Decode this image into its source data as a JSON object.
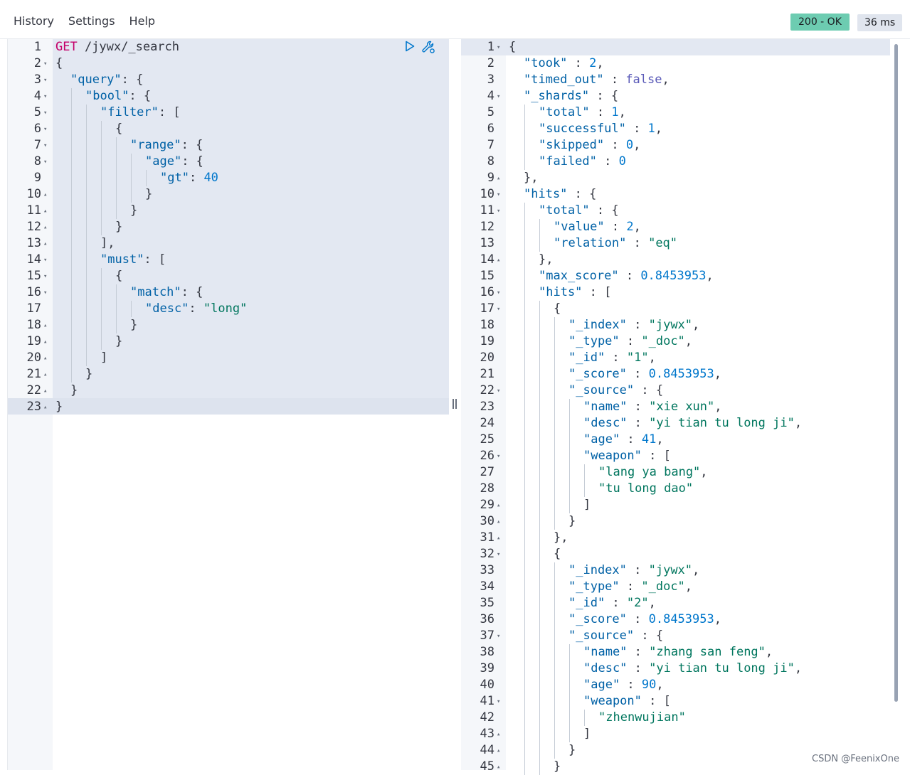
{
  "menu": {
    "history": "History",
    "settings": "Settings",
    "help": "Help"
  },
  "status": {
    "code": "200 - OK",
    "time": "36 ms"
  },
  "icons": {
    "run": "play-icon",
    "settings": "wrench-icon"
  },
  "request": {
    "lines": [
      {
        "n": "1",
        "fold": "",
        "tokens": [
          [
            "method",
            "GET"
          ],
          [
            "url",
            " /jywx/_search"
          ]
        ]
      },
      {
        "n": "2",
        "fold": "down",
        "tokens": [
          [
            "punc",
            "{"
          ]
        ]
      },
      {
        "n": "3",
        "fold": "down",
        "tokens": [
          [
            "key",
            "\"query\""
          ],
          [
            "punc",
            ": {"
          ]
        ]
      },
      {
        "n": "4",
        "fold": "down",
        "tokens": [
          [
            "key",
            "\"bool\""
          ],
          [
            "punc",
            ": {"
          ]
        ]
      },
      {
        "n": "5",
        "fold": "down",
        "tokens": [
          [
            "key",
            "\"filter\""
          ],
          [
            "punc",
            ": ["
          ]
        ]
      },
      {
        "n": "6",
        "fold": "down",
        "tokens": [
          [
            "punc",
            "{"
          ]
        ]
      },
      {
        "n": "7",
        "fold": "down",
        "tokens": [
          [
            "key",
            "\"range\""
          ],
          [
            "punc",
            ": {"
          ]
        ]
      },
      {
        "n": "8",
        "fold": "down",
        "tokens": [
          [
            "key",
            "\"age\""
          ],
          [
            "punc",
            ": {"
          ]
        ]
      },
      {
        "n": "9",
        "fold": "",
        "tokens": [
          [
            "key",
            "\"gt\""
          ],
          [
            "punc",
            ": "
          ],
          [
            "num",
            "40"
          ]
        ]
      },
      {
        "n": "10",
        "fold": "up",
        "tokens": [
          [
            "punc",
            "}"
          ]
        ]
      },
      {
        "n": "11",
        "fold": "up",
        "tokens": [
          [
            "punc",
            "}"
          ]
        ]
      },
      {
        "n": "12",
        "fold": "up",
        "tokens": [
          [
            "punc",
            "}"
          ]
        ]
      },
      {
        "n": "13",
        "fold": "up",
        "tokens": [
          [
            "punc",
            "],"
          ]
        ]
      },
      {
        "n": "14",
        "fold": "down",
        "tokens": [
          [
            "key",
            "\"must\""
          ],
          [
            "punc",
            ": ["
          ]
        ]
      },
      {
        "n": "15",
        "fold": "down",
        "tokens": [
          [
            "punc",
            "{"
          ]
        ]
      },
      {
        "n": "16",
        "fold": "down",
        "tokens": [
          [
            "key",
            "\"match\""
          ],
          [
            "punc",
            ": {"
          ]
        ]
      },
      {
        "n": "17",
        "fold": "",
        "tokens": [
          [
            "key",
            "\"desc\""
          ],
          [
            "punc",
            ": "
          ],
          [
            "str",
            "\"long\""
          ]
        ]
      },
      {
        "n": "18",
        "fold": "up",
        "tokens": [
          [
            "punc",
            "}"
          ]
        ]
      },
      {
        "n": "19",
        "fold": "up",
        "tokens": [
          [
            "punc",
            "}"
          ]
        ]
      },
      {
        "n": "20",
        "fold": "up",
        "tokens": [
          [
            "punc",
            "]"
          ]
        ]
      },
      {
        "n": "21",
        "fold": "up",
        "tokens": [
          [
            "punc",
            "}"
          ]
        ]
      },
      {
        "n": "22",
        "fold": "up",
        "tokens": [
          [
            "punc",
            "}"
          ]
        ]
      },
      {
        "n": "23",
        "fold": "up",
        "tokens": [
          [
            "punc",
            "}"
          ]
        ]
      }
    ]
  },
  "response": {
    "lines": [
      {
        "n": "1",
        "fold": "down",
        "tokens": [
          [
            "punc",
            "{"
          ]
        ]
      },
      {
        "n": "2",
        "fold": "",
        "tokens": [
          [
            "key",
            "\"took\""
          ],
          [
            "punc",
            " : "
          ],
          [
            "num",
            "2"
          ],
          [
            "punc",
            ","
          ]
        ]
      },
      {
        "n": "3",
        "fold": "",
        "tokens": [
          [
            "key",
            "\"timed_out\""
          ],
          [
            "punc",
            " : "
          ],
          [
            "bool",
            "false"
          ],
          [
            "punc",
            ","
          ]
        ]
      },
      {
        "n": "4",
        "fold": "down",
        "tokens": [
          [
            "key",
            "\"_shards\""
          ],
          [
            "punc",
            " : {"
          ]
        ]
      },
      {
        "n": "5",
        "fold": "",
        "tokens": [
          [
            "key",
            "\"total\""
          ],
          [
            "punc",
            " : "
          ],
          [
            "num",
            "1"
          ],
          [
            "punc",
            ","
          ]
        ]
      },
      {
        "n": "6",
        "fold": "",
        "tokens": [
          [
            "key",
            "\"successful\""
          ],
          [
            "punc",
            " : "
          ],
          [
            "num",
            "1"
          ],
          [
            "punc",
            ","
          ]
        ]
      },
      {
        "n": "7",
        "fold": "",
        "tokens": [
          [
            "key",
            "\"skipped\""
          ],
          [
            "punc",
            " : "
          ],
          [
            "num",
            "0"
          ],
          [
            "punc",
            ","
          ]
        ]
      },
      {
        "n": "8",
        "fold": "",
        "tokens": [
          [
            "key",
            "\"failed\""
          ],
          [
            "punc",
            " : "
          ],
          [
            "num",
            "0"
          ]
        ]
      },
      {
        "n": "9",
        "fold": "up",
        "tokens": [
          [
            "punc",
            "},"
          ]
        ]
      },
      {
        "n": "10",
        "fold": "down",
        "tokens": [
          [
            "key",
            "\"hits\""
          ],
          [
            "punc",
            " : {"
          ]
        ]
      },
      {
        "n": "11",
        "fold": "down",
        "tokens": [
          [
            "key",
            "\"total\""
          ],
          [
            "punc",
            " : {"
          ]
        ]
      },
      {
        "n": "12",
        "fold": "",
        "tokens": [
          [
            "key",
            "\"value\""
          ],
          [
            "punc",
            " : "
          ],
          [
            "num",
            "2"
          ],
          [
            "punc",
            ","
          ]
        ]
      },
      {
        "n": "13",
        "fold": "",
        "tokens": [
          [
            "key",
            "\"relation\""
          ],
          [
            "punc",
            " : "
          ],
          [
            "str",
            "\"eq\""
          ]
        ]
      },
      {
        "n": "14",
        "fold": "up",
        "tokens": [
          [
            "punc",
            "},"
          ]
        ]
      },
      {
        "n": "15",
        "fold": "",
        "tokens": [
          [
            "key",
            "\"max_score\""
          ],
          [
            "punc",
            " : "
          ],
          [
            "num",
            "0.8453953"
          ],
          [
            "punc",
            ","
          ]
        ]
      },
      {
        "n": "16",
        "fold": "down",
        "tokens": [
          [
            "key",
            "\"hits\""
          ],
          [
            "punc",
            " : ["
          ]
        ]
      },
      {
        "n": "17",
        "fold": "down",
        "tokens": [
          [
            "punc",
            "{"
          ]
        ]
      },
      {
        "n": "18",
        "fold": "",
        "tokens": [
          [
            "key",
            "\"_index\""
          ],
          [
            "punc",
            " : "
          ],
          [
            "str",
            "\"jywx\""
          ],
          [
            "punc",
            ","
          ]
        ]
      },
      {
        "n": "19",
        "fold": "",
        "tokens": [
          [
            "key",
            "\"_type\""
          ],
          [
            "punc",
            " : "
          ],
          [
            "str",
            "\"_doc\""
          ],
          [
            "punc",
            ","
          ]
        ]
      },
      {
        "n": "20",
        "fold": "",
        "tokens": [
          [
            "key",
            "\"_id\""
          ],
          [
            "punc",
            " : "
          ],
          [
            "str",
            "\"1\""
          ],
          [
            "punc",
            ","
          ]
        ]
      },
      {
        "n": "21",
        "fold": "",
        "tokens": [
          [
            "key",
            "\"_score\""
          ],
          [
            "punc",
            " : "
          ],
          [
            "num",
            "0.8453953"
          ],
          [
            "punc",
            ","
          ]
        ]
      },
      {
        "n": "22",
        "fold": "down",
        "tokens": [
          [
            "key",
            "\"_source\""
          ],
          [
            "punc",
            " : {"
          ]
        ]
      },
      {
        "n": "23",
        "fold": "",
        "tokens": [
          [
            "key",
            "\"name\""
          ],
          [
            "punc",
            " : "
          ],
          [
            "str",
            "\"xie xun\""
          ],
          [
            "punc",
            ","
          ]
        ]
      },
      {
        "n": "24",
        "fold": "",
        "tokens": [
          [
            "key",
            "\"desc\""
          ],
          [
            "punc",
            " : "
          ],
          [
            "str",
            "\"yi tian tu long ji\""
          ],
          [
            "punc",
            ","
          ]
        ]
      },
      {
        "n": "25",
        "fold": "",
        "tokens": [
          [
            "key",
            "\"age\""
          ],
          [
            "punc",
            " : "
          ],
          [
            "num",
            "41"
          ],
          [
            "punc",
            ","
          ]
        ]
      },
      {
        "n": "26",
        "fold": "down",
        "tokens": [
          [
            "key",
            "\"weapon\""
          ],
          [
            "punc",
            " : ["
          ]
        ]
      },
      {
        "n": "27",
        "fold": "",
        "tokens": [
          [
            "str",
            "\"lang ya bang\""
          ],
          [
            "punc",
            ","
          ]
        ]
      },
      {
        "n": "28",
        "fold": "",
        "tokens": [
          [
            "str",
            "\"tu long dao\""
          ]
        ]
      },
      {
        "n": "29",
        "fold": "up",
        "tokens": [
          [
            "punc",
            "]"
          ]
        ]
      },
      {
        "n": "30",
        "fold": "up",
        "tokens": [
          [
            "punc",
            "}"
          ]
        ]
      },
      {
        "n": "31",
        "fold": "up",
        "tokens": [
          [
            "punc",
            "},"
          ]
        ]
      },
      {
        "n": "32",
        "fold": "down",
        "tokens": [
          [
            "punc",
            "{"
          ]
        ]
      },
      {
        "n": "33",
        "fold": "",
        "tokens": [
          [
            "key",
            "\"_index\""
          ],
          [
            "punc",
            " : "
          ],
          [
            "str",
            "\"jywx\""
          ],
          [
            "punc",
            ","
          ]
        ]
      },
      {
        "n": "34",
        "fold": "",
        "tokens": [
          [
            "key",
            "\"_type\""
          ],
          [
            "punc",
            " : "
          ],
          [
            "str",
            "\"_doc\""
          ],
          [
            "punc",
            ","
          ]
        ]
      },
      {
        "n": "35",
        "fold": "",
        "tokens": [
          [
            "key",
            "\"_id\""
          ],
          [
            "punc",
            " : "
          ],
          [
            "str",
            "\"2\""
          ],
          [
            "punc",
            ","
          ]
        ]
      },
      {
        "n": "36",
        "fold": "",
        "tokens": [
          [
            "key",
            "\"_score\""
          ],
          [
            "punc",
            " : "
          ],
          [
            "num",
            "0.8453953"
          ],
          [
            "punc",
            ","
          ]
        ]
      },
      {
        "n": "37",
        "fold": "down",
        "tokens": [
          [
            "key",
            "\"_source\""
          ],
          [
            "punc",
            " : {"
          ]
        ]
      },
      {
        "n": "38",
        "fold": "",
        "tokens": [
          [
            "key",
            "\"name\""
          ],
          [
            "punc",
            " : "
          ],
          [
            "str",
            "\"zhang san feng\""
          ],
          [
            "punc",
            ","
          ]
        ]
      },
      {
        "n": "39",
        "fold": "",
        "tokens": [
          [
            "key",
            "\"desc\""
          ],
          [
            "punc",
            " : "
          ],
          [
            "str",
            "\"yi tian tu long ji\""
          ],
          [
            "punc",
            ","
          ]
        ]
      },
      {
        "n": "40",
        "fold": "",
        "tokens": [
          [
            "key",
            "\"age\""
          ],
          [
            "punc",
            " : "
          ],
          [
            "num",
            "90"
          ],
          [
            "punc",
            ","
          ]
        ]
      },
      {
        "n": "41",
        "fold": "down",
        "tokens": [
          [
            "key",
            "\"weapon\""
          ],
          [
            "punc",
            " : ["
          ]
        ]
      },
      {
        "n": "42",
        "fold": "",
        "tokens": [
          [
            "str",
            "\"zhenwujian\""
          ]
        ]
      },
      {
        "n": "43",
        "fold": "up",
        "tokens": [
          [
            "punc",
            "]"
          ]
        ]
      },
      {
        "n": "44",
        "fold": "up",
        "tokens": [
          [
            "punc",
            "}"
          ]
        ]
      },
      {
        "n": "45",
        "fold": "up",
        "tokens": [
          [
            "punc",
            "}"
          ]
        ]
      }
    ]
  },
  "watermark": "CSDN @FeenixOne"
}
